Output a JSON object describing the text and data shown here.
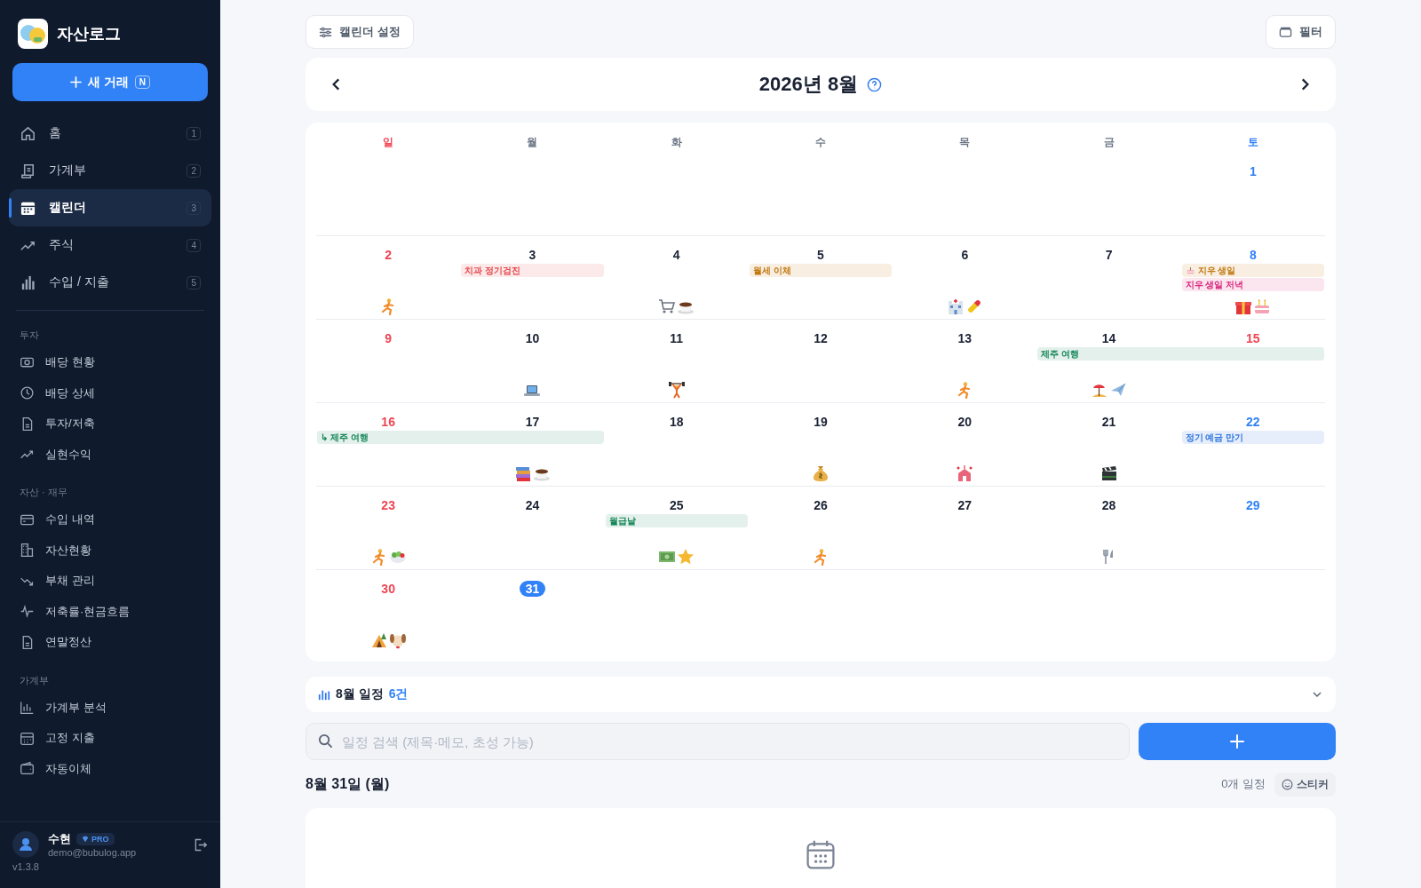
{
  "sidebar": {
    "app_name": "자산로그",
    "new_button": {
      "label": "새 거래",
      "shortcut": "N"
    },
    "nav": [
      {
        "label": "홈",
        "shortcut": "1",
        "selected": false
      },
      {
        "label": "가계부",
        "shortcut": "2",
        "selected": false
      },
      {
        "label": "캘린더",
        "shortcut": "3",
        "selected": true
      },
      {
        "label": "주식",
        "shortcut": "4",
        "selected": false
      },
      {
        "label": "수입 / 지출",
        "shortcut": "5",
        "selected": false
      }
    ],
    "sections": [
      {
        "title": "투자",
        "items": [
          "배당 현황",
          "배당 상세",
          "투자/저축",
          "실현수익"
        ]
      },
      {
        "title": "자산 · 재무",
        "items": [
          "수입 내역",
          "자산현황",
          "부채 관리",
          "저축률·현금흐름",
          "연말정산"
        ]
      },
      {
        "title": "가계부",
        "items": [
          "가계부 분석",
          "고정 지출",
          "자동이체"
        ]
      }
    ],
    "user": {
      "name": "수현",
      "badge": "PRO",
      "email": "demo@bubulog.app"
    },
    "version": "v1.3.8"
  },
  "toolbar": {
    "settings_button": "캘린더 설정",
    "filter_button": "필터"
  },
  "calendar": {
    "title": "2026년 8월",
    "weekdays": [
      "일",
      "월",
      "화",
      "수",
      "목",
      "금",
      "토"
    ],
    "weeks": [
      {
        "days": [
          {
            "date": "1",
            "selected": false
          }
        ]
      },
      {
        "days": [
          {
            "date": "2",
            "selected": false,
            "stickers": [
              {
                "kind": "runner"
              }
            ]
          },
          {
            "date": "3",
            "selected": false,
            "events": [
              {
                "label": "치과 정기검진",
                "color": "#e5484d",
                "kind": "single"
              }
            ]
          },
          {
            "date": "4",
            "selected": false,
            "stickers": [
              {
                "kind": "cart"
              },
              {
                "kind": "coffee"
              }
            ]
          },
          {
            "date": "5",
            "selected": false,
            "events": [
              {
                "label": "월세 이체",
                "color": "#c27810",
                "kind": "single"
              }
            ]
          },
          {
            "date": "6",
            "selected": false,
            "stickers": [
              {
                "kind": "hospital"
              },
              {
                "kind": "pill"
              }
            ]
          },
          {
            "date": "7",
            "selected": false
          },
          {
            "date": "8",
            "selected": false,
            "events": [
              {
                "label": "지우 생일",
                "color": "#c27810",
                "kind": "birthday"
              },
              {
                "label": "지우 생일 저녁",
                "color": "#db2a7d",
                "kind": "single"
              }
            ],
            "stickers": [
              {
                "kind": "gift"
              },
              {
                "kind": "cake"
              }
            ]
          }
        ]
      },
      {
        "days": [
          {
            "date": "9",
            "selected": false
          },
          {
            "date": "10",
            "selected": false,
            "stickers": [
              {
                "kind": "laptop"
              }
            ]
          },
          {
            "date": "11",
            "selected": false,
            "stickers": [
              {
                "kind": "weightlifter"
              }
            ]
          },
          {
            "date": "12",
            "selected": false
          },
          {
            "date": "13",
            "selected": false,
            "stickers": [
              {
                "kind": "runner"
              }
            ]
          },
          {
            "date": "14",
            "selected": false,
            "events": [
              {
                "label": "제주 여행",
                "color": "#17875a",
                "kind": "multi"
              }
            ],
            "stickers": [
              {
                "kind": "beach"
              },
              {
                "kind": "airplane"
              }
            ]
          },
          {
            "date": "15",
            "selected": false,
            "holiday": true
          }
        ]
      },
      {
        "days": [
          {
            "date": "16",
            "selected": false,
            "events": [
              {
                "label": "↳ 제주 여행",
                "color": "#17875a",
                "kind": "multi"
              }
            ]
          },
          {
            "date": "17",
            "selected": false,
            "stickers": [
              {
                "kind": "books"
              },
              {
                "kind": "coffee"
              }
            ]
          },
          {
            "date": "18",
            "selected": false
          },
          {
            "date": "19",
            "selected": false,
            "stickers": [
              {
                "kind": "moneybag"
              }
            ]
          },
          {
            "date": "20",
            "selected": false,
            "stickers": [
              {
                "kind": "wedding"
              }
            ]
          },
          {
            "date": "21",
            "selected": false,
            "stickers": [
              {
                "kind": "clapper"
              }
            ]
          },
          {
            "date": "22",
            "selected": false,
            "events": [
              {
                "label": "정기 예금 만기",
                "color": "#2f74e0",
                "kind": "single"
              }
            ]
          }
        ]
      },
      {
        "days": [
          {
            "date": "23",
            "selected": false,
            "stickers": [
              {
                "kind": "runner"
              },
              {
                "kind": "salad"
              }
            ]
          },
          {
            "date": "24",
            "selected": false
          },
          {
            "date": "25",
            "selected": false,
            "events": [
              {
                "label": "월급날",
                "color": "#17875a",
                "kind": "single"
              }
            ],
            "stickers": [
              {
                "kind": "cash"
              },
              {
                "kind": "star"
              }
            ]
          },
          {
            "date": "26",
            "selected": false,
            "stickers": [
              {
                "kind": "runner"
              }
            ]
          },
          {
            "date": "27",
            "selected": false
          },
          {
            "date": "28",
            "selected": false,
            "stickers": [
              {
                "kind": "cutlery"
              }
            ]
          },
          {
            "date": "29",
            "selected": false
          }
        ]
      },
      {
        "days": [
          {
            "date": "30",
            "selected": false,
            "stickers": [
              {
                "kind": "camping"
              },
              {
                "kind": "dog"
              }
            ]
          },
          {
            "date": "31",
            "selected": true
          }
        ]
      }
    ]
  },
  "summary": {
    "label": "8월 일정",
    "count": "6건",
    "expanded": false
  },
  "search": {
    "placeholder": "일정 검색 (제목·메모, 초성 가능)"
  },
  "day_detail": {
    "title": "8월 31일 (월)",
    "count": "0개 일정",
    "sticker_button": "스티커"
  }
}
